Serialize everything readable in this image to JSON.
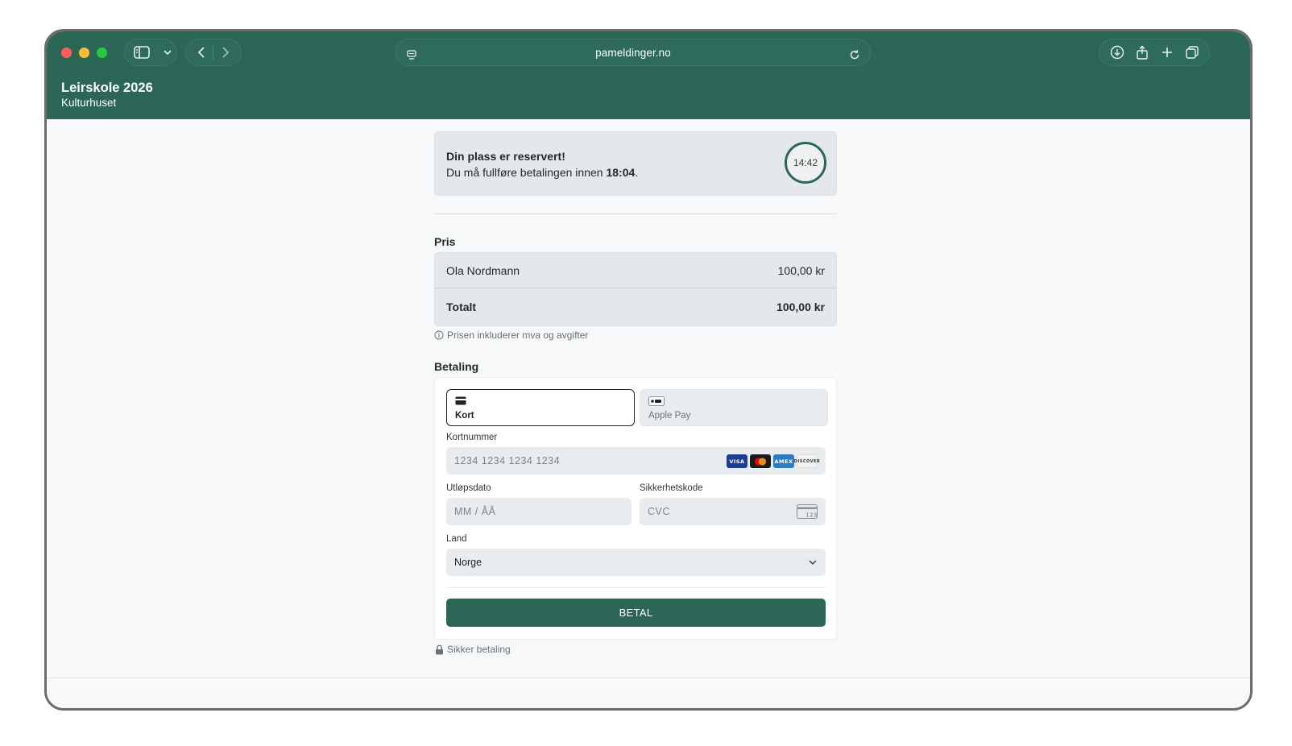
{
  "browser": {
    "url": "pameldinger.no"
  },
  "header": {
    "event_title": "Leirskole 2026",
    "venue": "Kulturhuset"
  },
  "reservation": {
    "title": "Din plass er reservert!",
    "message_prefix": "Du må fullføre betalingen innen ",
    "deadline": "18:04",
    "message_suffix": ".",
    "countdown": "14:42"
  },
  "price": {
    "section_label": "Pris",
    "items": [
      {
        "name": "Ola Nordmann",
        "amount": "100,00 kr"
      }
    ],
    "total_label": "Totalt",
    "total_amount": "100,00 kr",
    "vat_note": "Prisen inkluderer mva og avgifter"
  },
  "payment": {
    "section_label": "Betaling",
    "methods": [
      {
        "label": "Kort",
        "selected": true
      },
      {
        "label": "Apple Pay",
        "selected": false
      }
    ],
    "card_number_label": "Kortnummer",
    "card_number_placeholder": "1234 1234 1234 1234",
    "card_brands": [
      "VISA",
      "Mastercard",
      "AMEX",
      "DISCOVER"
    ],
    "expiry_label": "Utløpsdato",
    "expiry_placeholder": "MM / ÅÅ",
    "cvc_label": "Sikkerhetskode",
    "cvc_placeholder": "CVC",
    "country_label": "Land",
    "country_value": "Norge",
    "pay_button": "BETAL",
    "secure_note": "Sikker betaling"
  },
  "colors": {
    "brand": "#2c6657",
    "panel": "#e5e8ea",
    "input": "#e8ecef"
  }
}
